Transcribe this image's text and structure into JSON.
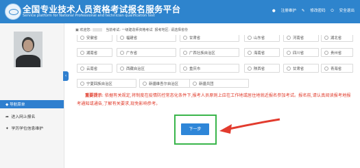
{
  "header": {
    "title": "全国专业技术人员资格考试报名服务平台",
    "subtitle": "Service platform for National Professional and technician qualification test",
    "links": [
      "注册维护",
      "修改密码",
      "安全退出"
    ]
  },
  "sidebar": {
    "nav_header": "导航菜单",
    "items": [
      "进入网上报名",
      "学历学位信息维护"
    ],
    "collapse": "‹"
  },
  "breadcrumb": {
    "welcome": "欢迎您:",
    "exam_label": "当前考试: 一级建造师资格考试",
    "region_label": "报考地区: 请选择省份"
  },
  "provinces": [
    [
      "安徽省",
      "福建省",
      "甘肃省",
      "山东省",
      "河南省",
      "湖北省"
    ],
    [
      "湖南省",
      "广东省",
      "广西壮族自治区",
      "海南省",
      "四川省",
      "贵州省"
    ],
    [
      "云南省",
      "西藏自治区",
      "重庆市",
      "陕西省",
      "甘肃省",
      "青海省"
    ],
    [
      "宁夏回族自治区",
      "新疆维吾尔自治区",
      "新疆兵团"
    ]
  ],
  "notice": {
    "label": "重要提示",
    "text": ": 依据有关规定,将制度在疫情防控常态化条件下,报考人员原则上应在工作地或居住地就近报名参加考试。报名前,请认真阅读报考地报考通知或通告,了解有关要求,现免影响参考。"
  },
  "next_button": "下一步",
  "colors": {
    "primary": "#2e84cd",
    "warning": "#e03a2a",
    "highlight": "#39b54a"
  }
}
